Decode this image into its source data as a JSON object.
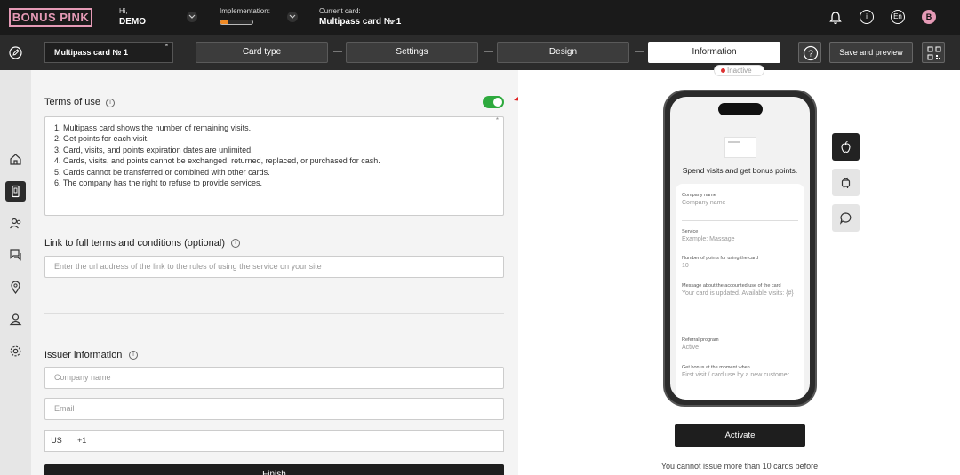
{
  "brand": {
    "logo": "BONUS PINK",
    "accent": "#e59ab6"
  },
  "header": {
    "greeting": "Hi,",
    "user": "DEMO",
    "implementation_label": "Implementation:",
    "implementation_progress": 0.25,
    "current_card_label": "Current card:",
    "current_card": "Multipass card № 1",
    "lang": "En",
    "avatar_letter": "B",
    "icons": [
      "bell-icon",
      "info-icon"
    ]
  },
  "stepbar": {
    "card_name": "Multipass card № 1",
    "required_mark": "*",
    "steps": [
      "Card type",
      "Settings",
      "Design",
      "Information"
    ],
    "active_step": "Information",
    "save_label": "Save and preview"
  },
  "form": {
    "terms_label": "Terms of use",
    "terms_enabled": true,
    "terms_lines": [
      "1. Multipass card shows the number of remaining visits.",
      "2. Get points for each visit.",
      "3. Card, visits, and points expiration dates are unlimited.",
      "4. Cards, visits, and points cannot be exchanged, returned, replaced, or purchased for cash.",
      "5. Cards cannot be transferred or combined with other cards.",
      "6. The company has the right to refuse to provide services."
    ],
    "link_label": "Link to full terms and conditions (optional)",
    "link_placeholder": "Enter the url address of the link to the rules of using the service on your site",
    "issuer_label": "Issuer information",
    "company_placeholder": "Company name",
    "email_placeholder": "Email",
    "country_code": "US",
    "phone_prefix": "+1",
    "finish_label": "Finish"
  },
  "preview": {
    "status": "Inactive",
    "status_color": "#dd3333",
    "tagline": "Spend visits and get bonus points.",
    "fields": [
      {
        "label": "Company name",
        "value": "Company name"
      },
      {
        "label": "Service",
        "value": "Example: Massage"
      },
      {
        "label": "Number of points for using the card",
        "value": "10"
      },
      {
        "label": "Message about the accounted use of the card",
        "value": "Your card is updated. Available visits: {#}"
      },
      {
        "label": "Referral program",
        "value": "Active"
      },
      {
        "label": "Get bonus at the moment when",
        "value": "First visit / card use by a new customer"
      }
    ],
    "platforms": [
      "apple-icon",
      "android-icon",
      "chat-icon"
    ],
    "activate_label": "Activate",
    "limit_note": "You cannot issue more than 10 cards before"
  }
}
